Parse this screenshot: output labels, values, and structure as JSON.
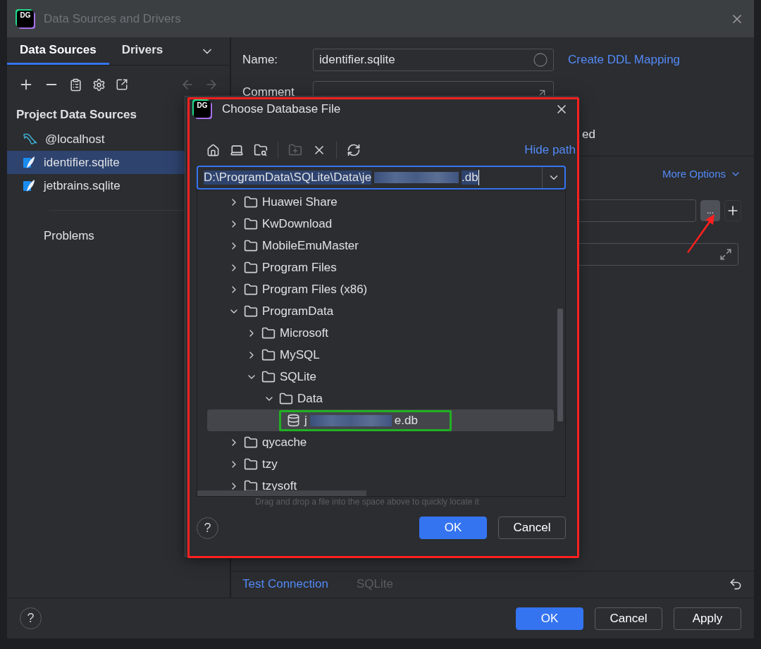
{
  "window": {
    "title": "Data Sources and Drivers",
    "logo": "DG"
  },
  "sidebar": {
    "tabs": [
      {
        "label": "Data Sources",
        "selected": true
      },
      {
        "label": "Drivers",
        "selected": false
      }
    ],
    "section_title": "Project Data Sources",
    "items": [
      {
        "label": "@localhost",
        "kind": "mysql",
        "selected": false
      },
      {
        "label": "identifier.sqlite",
        "kind": "sqlite",
        "selected": true
      },
      {
        "label": "jetbrains.sqlite",
        "kind": "sqlite",
        "selected": false
      }
    ],
    "problems": "Problems"
  },
  "form": {
    "name_label": "Name:",
    "name_value": "identifier.sqlite",
    "comment_label": "Comment",
    "ddl_link": "Create DDL Mapping",
    "partial_text": "ed",
    "more_options": "More Options",
    "browse_button": "..."
  },
  "dialog": {
    "title": "Choose Database File",
    "logo": "DG",
    "hide_path": "Hide path",
    "path_start": "D:\\ProgramData\\SQLite\\Data\\je",
    "path_end": ".db",
    "tree": [
      {
        "name": "Huawei Share",
        "kind": "folder",
        "expanded": false,
        "selected": false
      },
      {
        "name": "KwDownload",
        "kind": "folder",
        "expanded": false,
        "selected": false
      },
      {
        "name": "MobileEmuMaster",
        "kind": "folder",
        "expanded": false,
        "selected": false
      },
      {
        "name": "Program Files",
        "kind": "folder",
        "expanded": false,
        "selected": false
      },
      {
        "name": "Program Files (x86)",
        "kind": "folder",
        "expanded": false,
        "selected": false
      },
      {
        "name": "ProgramData",
        "kind": "folder",
        "expanded": true,
        "selected": false,
        "children": [
          {
            "name": "Microsoft",
            "kind": "folder",
            "expanded": false,
            "selected": false
          },
          {
            "name": "MySQL",
            "kind": "folder",
            "expanded": false,
            "selected": false
          },
          {
            "name": "SQLite",
            "kind": "folder",
            "expanded": true,
            "selected": false,
            "children": [
              {
                "name": "Data",
                "kind": "folder",
                "expanded": true,
                "selected": false,
                "children": [
                  {
                    "name_start": "j",
                    "name_end": "e.db",
                    "kind": "file",
                    "selected": true
                  }
                ]
              }
            ]
          }
        ]
      },
      {
        "name": "qycache",
        "kind": "folder",
        "expanded": false,
        "selected": false
      },
      {
        "name": "tzy",
        "kind": "folder",
        "expanded": false,
        "selected": false
      },
      {
        "name": "tzysoft",
        "kind": "folder",
        "expanded": false,
        "selected": false
      }
    ],
    "hint": "Drag and drop a file into the space above to quickly locate it",
    "help": "?",
    "buttons": [
      {
        "label": "OK",
        "primary": true
      },
      {
        "label": "Cancel",
        "primary": false
      }
    ]
  },
  "bottom_bar": {
    "test_connection": "Test Connection",
    "driver": "SQLite"
  },
  "footer": {
    "help": "?",
    "buttons": [
      {
        "label": "OK",
        "primary": true
      },
      {
        "label": "Cancel",
        "primary": false
      },
      {
        "label": "Apply",
        "primary": false
      }
    ]
  }
}
